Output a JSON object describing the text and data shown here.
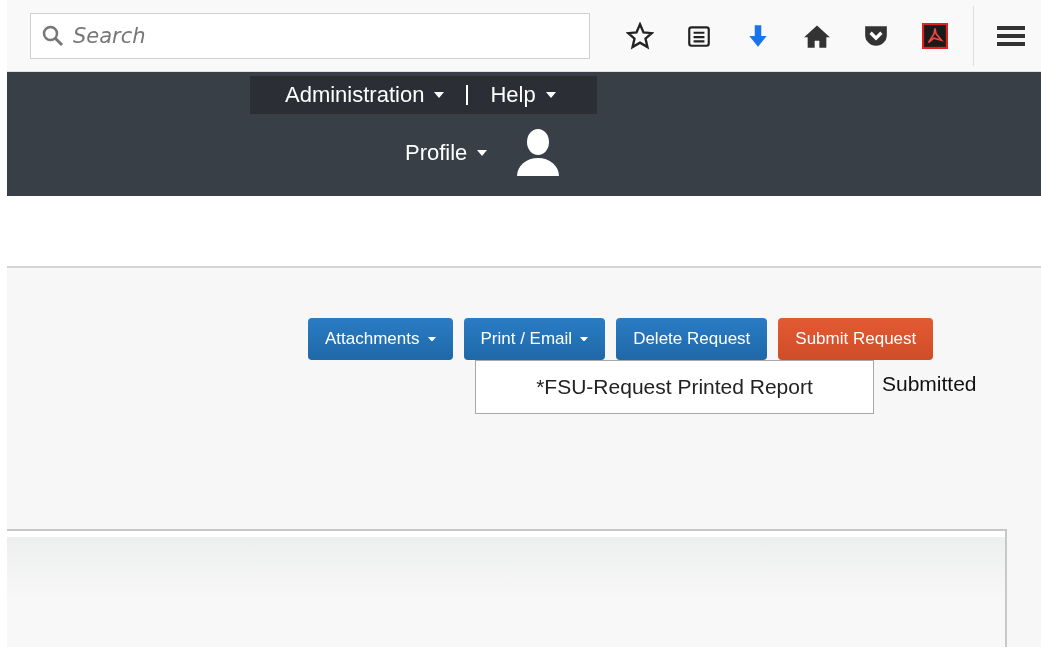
{
  "browser_toolbar": {
    "search": {
      "placeholder": "Search"
    }
  },
  "top_nav": {
    "menus": [
      {
        "label": "Administration"
      },
      {
        "label": "Help"
      }
    ],
    "profile": {
      "label": "Profile"
    }
  },
  "actions": [
    {
      "label": "Attachments",
      "kind": "primary",
      "has_caret": true
    },
    {
      "label": "Print / Email",
      "kind": "primary",
      "has_caret": true
    },
    {
      "label": "Delete Request",
      "kind": "primary",
      "has_caret": false
    },
    {
      "label": "Submit Request",
      "kind": "danger",
      "has_caret": false
    }
  ],
  "print_menu": {
    "items": [
      {
        "label": "*FSU-Request Printed Report"
      }
    ]
  },
  "status": "Submitted"
}
